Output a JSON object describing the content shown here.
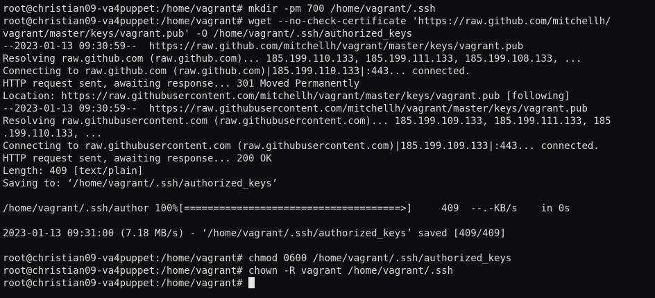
{
  "terminal": {
    "prompt": "root@christian09-va4puppet:/home/vagrant# ",
    "lines": [
      "root@christian09-va4puppet:/home/vagrant# mkdir -pm 700 /home/vagrant/.ssh",
      "root@christian09-va4puppet:/home/vagrant# wget --no-check-certificate 'https://raw.github.com/mitchellh/",
      "vagrant/master/keys/vagrant.pub' -O /home/vagrant/.ssh/authorized_keys",
      "--2023-01-13 09:30:59--  https://raw.github.com/mitchellh/vagrant/master/keys/vagrant.pub",
      "Resolving raw.github.com (raw.github.com)... 185.199.110.133, 185.199.111.133, 185.199.108.133, ...",
      "Connecting to raw.github.com (raw.github.com)|185.199.110.133|:443... connected.",
      "HTTP request sent, awaiting response... 301 Moved Permanently",
      "Location: https://raw.githubusercontent.com/mitchellh/vagrant/master/keys/vagrant.pub [following]",
      "--2023-01-13 09:30:59--  https://raw.githubusercontent.com/mitchellh/vagrant/master/keys/vagrant.pub",
      "Resolving raw.githubusercontent.com (raw.githubusercontent.com)... 185.199.109.133, 185.199.111.133, 185",
      ".199.110.133, ...",
      "Connecting to raw.githubusercontent.com (raw.githubusercontent.com)|185.199.109.133|:443... connected.",
      "HTTP request sent, awaiting response... 200 OK",
      "Length: 409 [text/plain]",
      "Saving to: ‘/home/vagrant/.ssh/authorized_keys’",
      "",
      "/home/vagrant/.ssh/author 100%[=====================================>]     409  --.-KB/s    in 0s",
      "",
      "2023-01-13 09:31:00 (7.18 MB/s) - ‘/home/vagrant/.ssh/authorized_keys’ saved [409/409]",
      "",
      "root@christian09-va4puppet:/home/vagrant# chmod 0600 /home/vagrant/.ssh/authorized_keys",
      "root@christian09-va4puppet:/home/vagrant# chown -R vagrant /home/vagrant/.ssh"
    ]
  }
}
